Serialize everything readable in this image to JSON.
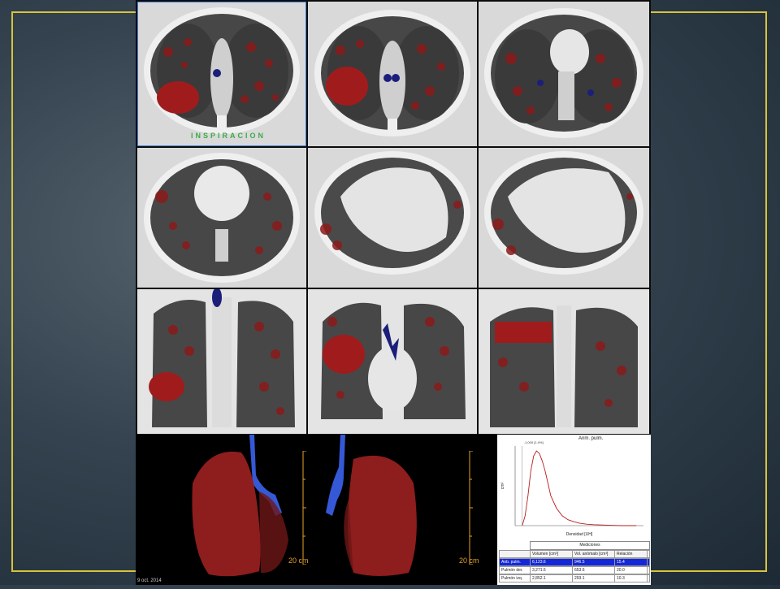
{
  "slide": {
    "insp_label": "INSPIRACION",
    "date_label": "9 oct. 2014",
    "accent_color": "#d8c33a"
  },
  "renders": {
    "left_scale": "20 cm",
    "right_scale": "20 cm"
  },
  "chart_data": {
    "type": "line",
    "title": "Anm. pulm.",
    "xlabel": "Densidad [UH]",
    "ylabel": "cm³",
    "marker_label": "-1,000 [1.4%]",
    "series": [
      {
        "x": [
          -1000,
          -980,
          -960,
          -940,
          -920,
          -900,
          -880,
          -860,
          -840,
          -820,
          -800,
          -760,
          -720,
          -680,
          -640,
          -600,
          -550,
          -500,
          -400,
          -300,
          -200
        ],
        "values": [
          0,
          20,
          60,
          110,
          140,
          150,
          145,
          130,
          110,
          85,
          60,
          35,
          20,
          12,
          8,
          5,
          3,
          2,
          1,
          0,
          0
        ]
      }
    ],
    "xlim": [
      -1050,
      -150
    ],
    "ylim": [
      0,
      160
    ]
  },
  "table": {
    "header": "Mediciones",
    "columns": [
      "",
      "Volumen [cm³]",
      "Vol. anómalo [cm³]",
      "Relación"
    ],
    "rows": [
      [
        "Anb. pulm.",
        "6,123.6",
        "946.5",
        "15.4"
      ],
      [
        "Pulmón der.",
        "3,271.5",
        "653.6",
        "20.0"
      ],
      [
        "Pulmón izq.",
        "2,852.1",
        "293.1",
        "10.3"
      ]
    ]
  }
}
